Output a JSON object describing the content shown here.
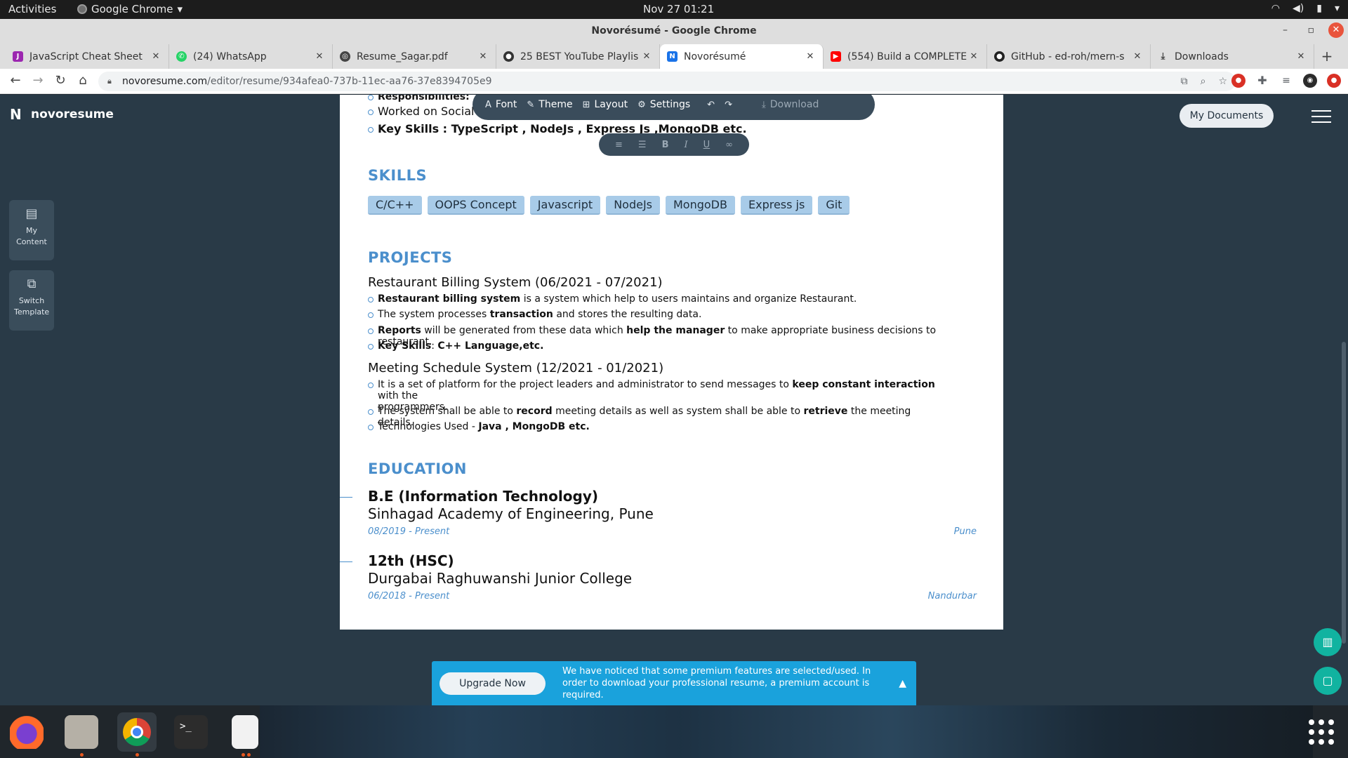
{
  "topbar": {
    "activities": "Activities",
    "app_name": "Google Chrome",
    "clock": "Nov 27  01:21"
  },
  "window": {
    "title": "Novorésumé - Google Chrome"
  },
  "tabs": [
    {
      "title": "JavaScript Cheat Sheet",
      "icon": "javascript-icon",
      "color": "#9c27b0"
    },
    {
      "title": "(24) WhatsApp",
      "icon": "whatsapp-icon",
      "color": "#25d366"
    },
    {
      "title": "Resume_Sagar.pdf",
      "icon": "globe-icon",
      "color": "#444444"
    },
    {
      "title": "25 BEST YouTube Playlis",
      "icon": "github-icon",
      "color": "#333333"
    },
    {
      "title": "Novorésumé",
      "icon": "novoresume-icon",
      "color": "#1a73e8",
      "active": true
    },
    {
      "title": "(554) Build a COMPLETE",
      "icon": "youtube-icon",
      "color": "#ff0000"
    },
    {
      "title": "GitHub - ed-roh/mern-s",
      "icon": "github-icon",
      "color": "#222222"
    },
    {
      "title": "Downloads",
      "icon": "download-icon",
      "color": "#444444"
    }
  ],
  "omnibox": {
    "host": "novoresume.com",
    "path": "/editor/resume/934afea0-737b-11ec-aa76-37e8394705e9"
  },
  "app": {
    "brand": "novoresume",
    "sidebar": [
      {
        "label": "My Content",
        "icon": "folder-icon"
      },
      {
        "label": "Switch Template",
        "icon": "switch-template-icon"
      }
    ],
    "my_documents": "My Documents"
  },
  "editor_toolbar": {
    "font": "Font",
    "theme": "Theme",
    "layout": "Layout",
    "settings": "Settings",
    "download": "Download"
  },
  "resume": {
    "exp_partial": {
      "responsibilities": "Responsibilities:",
      "line1": "Worked on Social m",
      "keyskills_label": "Key Skills : TypeScript , NodeJs , Express Js ,MongoDB etc."
    },
    "skills_title": "SKILLS",
    "skills": [
      "C/C++",
      "OOPS Concept",
      "Javascript",
      "NodeJs",
      "MongoDB",
      "Express js",
      "Git"
    ],
    "projects_title": "PROJECTS",
    "projects": [
      {
        "title": "Restaurant Billing System (06/2021 - 07/2021)",
        "b1_bold": "Restaurant billing system",
        "b1_rest": " is a system which help to users maintains and organize Restaurant.",
        "b2_pre": "The system processes ",
        "b2_bold": "transaction",
        "b2_post": " and stores the resulting data.",
        "b3_bold": "Reports",
        "b3_mid": " will be generated from these data which ",
        "b3_bold2": "help the manager",
        "b3_post": " to make appropriate business decisions to restaurant.",
        "b4_bold": "Key Skills",
        "b4_mid": ": ",
        "b4_bold2": "C++ Language,etc."
      },
      {
        "title": "Meeting Schedule System (12/2021 - 01/2021)",
        "b1_pre": "It is a set of platform for the project leaders and administrator to send messages to ",
        "b1_bold": "keep constant interaction",
        "b1_post": " with the",
        "b1_cont": "programmers.",
        "b2_pre": "The system shall be able to ",
        "b2_bold": "record",
        "b2_mid": " meeting details as well as system shall be able to ",
        "b2_bold2": "retrieve",
        "b2_post": " the meeting details.",
        "b3_pre": "Technologies Used - ",
        "b3_bold": "Java , MongoDB etc."
      }
    ],
    "education_title": "EDUCATION",
    "education": [
      {
        "degree": "B.E (Information Technology)",
        "school": "Sinhagad Academy of Engineering, Pune",
        "date": "08/2019 - Present",
        "location": "Pune"
      },
      {
        "degree": "12th (HSC)",
        "school": "Durgabai Raghuwanshi Junior College",
        "date": "06/2018 - Present",
        "location": "Nandurbar"
      }
    ]
  },
  "premium": {
    "button": "Upgrade Now",
    "message": "We have noticed that some premium features are selected/used. In order to download your professional resume, a premium account is required."
  },
  "colors": {
    "accent": "#4b8fcc",
    "page_bg": "#293a47",
    "premium_bg": "#1aa2dc"
  }
}
